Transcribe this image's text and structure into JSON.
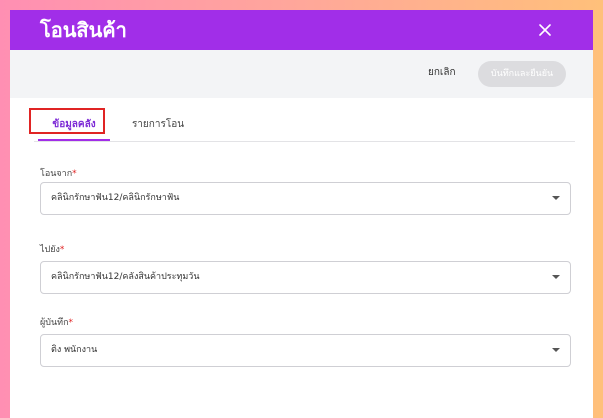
{
  "dialog": {
    "title": "โอนสินค้า",
    "close_icon": "close-icon"
  },
  "actions": {
    "cancel_label": "ยกเลิก",
    "confirm_label": "บันทึกและยืนยัน"
  },
  "tabs": [
    {
      "label": "ข้อมูลคลัง",
      "active": true
    },
    {
      "label": "รายการโอน",
      "active": false
    }
  ],
  "form": {
    "from": {
      "label": "โอนจาก",
      "required_mark": "*",
      "value": "คลินิกรักษาฟัน12/คลินิกรักษาฟัน"
    },
    "to": {
      "label": "ไปยัง",
      "required_mark": "*",
      "value": "คลินิกรักษาฟัน12/คลังสินค้าประทุมวัน"
    },
    "recorder": {
      "label": "ผู้บันทึก",
      "required_mark": "*",
      "value": "ติง พนักงาน"
    }
  },
  "colors": {
    "header": "#a12ee8",
    "highlight": "#e02424",
    "required": "#e02424"
  }
}
